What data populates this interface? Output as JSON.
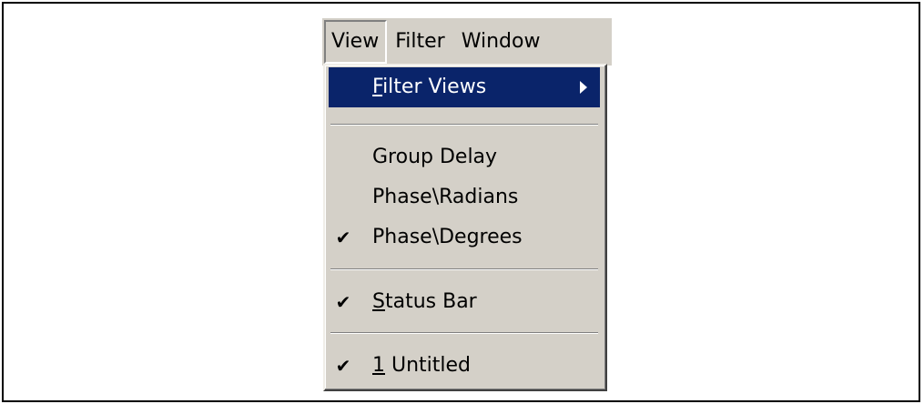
{
  "menubar": {
    "items": [
      {
        "label": "View",
        "active": true
      },
      {
        "label": "Filter",
        "active": false
      },
      {
        "label": "Window",
        "active": false
      }
    ]
  },
  "view_menu": {
    "filter_views": {
      "mnemonic": "F",
      "rest": "ilter Views",
      "highlighted": true,
      "submenu_arrow": "right-triangle-icon"
    },
    "group_delay": {
      "label": "Group Delay",
      "checked": false
    },
    "phase_radians": {
      "label": "Phase\\Radians",
      "checked": false
    },
    "phase_degrees": {
      "label": "Phase\\Degrees",
      "checked": true
    },
    "status_bar": {
      "mnemonic": "S",
      "rest": "tatus Bar",
      "checked": true
    },
    "untitled": {
      "mnemonic": "1",
      "rest": " Untitled",
      "checked": true
    },
    "check_glyph": "✔"
  },
  "colors": {
    "menu_background": "#d4d0c8",
    "highlight_background": "#0a246a",
    "highlight_text": "#ffffff"
  }
}
